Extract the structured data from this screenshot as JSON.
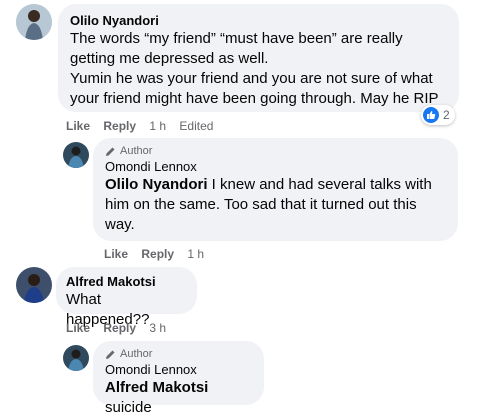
{
  "comments": [
    {
      "author": "Olilo Nyandori",
      "lines": [
        "The words “my friend” “must have been” are really",
        "getting me depressed as well.",
        "Yumin he was your friend and you are not sure of what",
        "your friend might have been going through. May he RIP"
      ],
      "actions": {
        "like": "Like",
        "reply": "Reply",
        "time": "1 h",
        "edited": "Edited"
      },
      "reactions": {
        "count": "2",
        "icon": "like-icon",
        "color": "#1877f2"
      }
    },
    {
      "badge": "Author",
      "author": "Omondi Lennox",
      "mention": "Olilo Nyandori",
      "lines": [
        " I knew and had several talks with",
        "him on the same. Too sad that it turned out this",
        "way."
      ],
      "actions": {
        "like": "Like",
        "reply": "Reply",
        "time": "1 h"
      }
    },
    {
      "author": "Alfred Makotsi",
      "lines": [
        "What happened??"
      ],
      "actions": {
        "like": "Like",
        "reply": "Reply",
        "time": "3 h"
      }
    },
    {
      "badge": "Author",
      "author": "Omondi Lennox",
      "mention": "Alfred Makotsi",
      "lines": [
        " suicide"
      ]
    }
  ]
}
